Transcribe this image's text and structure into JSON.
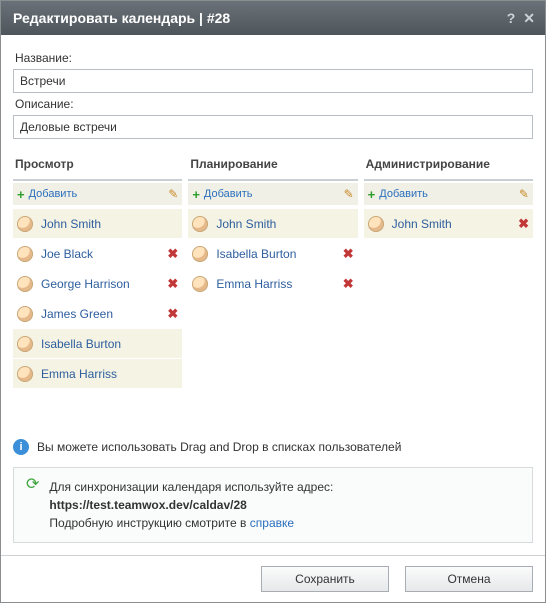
{
  "title": "Редактировать календарь | #28",
  "labels": {
    "name": "Название:",
    "description": "Описание:"
  },
  "fields": {
    "name": "Встречи",
    "description": "Деловые встречи"
  },
  "columns": {
    "view": {
      "title": "Просмотр",
      "add": "Добавить",
      "users": [
        {
          "name": "John Smith",
          "hl": true,
          "removable": false
        },
        {
          "name": "Joe Black",
          "hl": false,
          "removable": true
        },
        {
          "name": "George Harrison",
          "hl": false,
          "removable": true
        },
        {
          "name": "James Green",
          "hl": false,
          "removable": true
        },
        {
          "name": "Isabella Burton",
          "hl": true,
          "removable": false
        },
        {
          "name": "Emma Harriss",
          "hl": true,
          "removable": false
        }
      ]
    },
    "plan": {
      "title": "Планирование",
      "add": "Добавить",
      "users": [
        {
          "name": "John Smith",
          "hl": true,
          "removable": false
        },
        {
          "name": "Isabella Burton",
          "hl": false,
          "removable": true
        },
        {
          "name": "Emma Harriss",
          "hl": false,
          "removable": true
        }
      ]
    },
    "admin": {
      "title": "Администрирование",
      "add": "Добавить",
      "users": [
        {
          "name": "John Smith",
          "hl": true,
          "removable": true
        }
      ]
    }
  },
  "hint": "Вы можете использовать Drag and Drop в списках пользователей",
  "sync": {
    "intro": "Для синхронизации календаря используйте адрес:",
    "url": "https://test.teamwox.dev/caldav/28",
    "more_prefix": "Подробную инструкцию смотрите в ",
    "more_link": "справке"
  },
  "buttons": {
    "save": "Сохранить",
    "cancel": "Отмена"
  }
}
